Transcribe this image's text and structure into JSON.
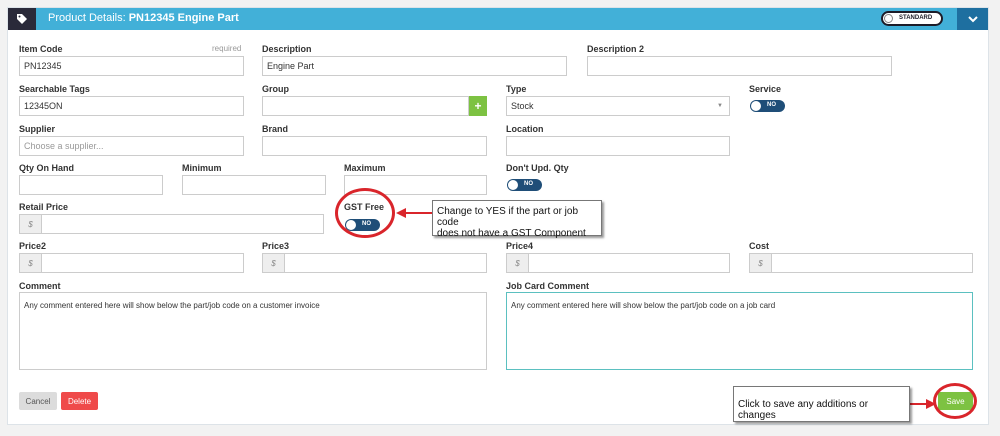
{
  "header": {
    "label": "Product Details:",
    "product": "PN12345 Engine Part",
    "toggle_label": "STANDARD"
  },
  "fields": {
    "item_code": {
      "label": "Item Code",
      "required": "required",
      "value": "PN12345"
    },
    "description": {
      "label": "Description",
      "value": "Engine Part"
    },
    "description2": {
      "label": "Description 2",
      "value": ""
    },
    "searchable_tags": {
      "label": "Searchable Tags",
      "value": "12345ON"
    },
    "group": {
      "label": "Group",
      "value": "",
      "add_label": "+"
    },
    "type": {
      "label": "Type",
      "value": "Stock"
    },
    "service": {
      "label": "Service",
      "toggle": "NO"
    },
    "supplier": {
      "label": "Supplier",
      "placeholder": "Choose a supplier..."
    },
    "brand": {
      "label": "Brand",
      "value": ""
    },
    "location": {
      "label": "Location",
      "value": ""
    },
    "qty_on_hand": {
      "label": "Qty On Hand",
      "value": ""
    },
    "minimum": {
      "label": "Minimum",
      "value": ""
    },
    "maximum": {
      "label": "Maximum",
      "value": ""
    },
    "dont_upd_qty": {
      "label": "Don't Upd. Qty",
      "toggle": "NO"
    },
    "retail_price": {
      "label": "Retail Price",
      "currency": "$",
      "value": ""
    },
    "gst_free": {
      "label": "GST Free",
      "toggle": "NO"
    },
    "price2": {
      "label": "Price2",
      "currency": "$",
      "value": ""
    },
    "price3": {
      "label": "Price3",
      "currency": "$",
      "value": ""
    },
    "price4": {
      "label": "Price4",
      "currency": "$",
      "value": ""
    },
    "cost": {
      "label": "Cost",
      "currency": "$",
      "value": ""
    },
    "comment": {
      "label": "Comment",
      "value": "Any comment entered here will show below the part/job code on a customer invoice"
    },
    "job_card_comment": {
      "label": "Job Card Comment",
      "value": "Any comment entered here will show below the part/job code on a job card"
    }
  },
  "buttons": {
    "cancel": "Cancel",
    "delete": "Delete",
    "save": "Save"
  },
  "callouts": {
    "gst_line1": "Change to YES if the part or job code",
    "gst_line2": "does not have a GST Component",
    "save": "Click to save any additions or changes"
  },
  "colors": {
    "header": "#42b0d8",
    "toggle_on": "#1f4e78",
    "save": "#7dc242",
    "delete": "#ef4a4a",
    "annotation": "#d9252b"
  }
}
